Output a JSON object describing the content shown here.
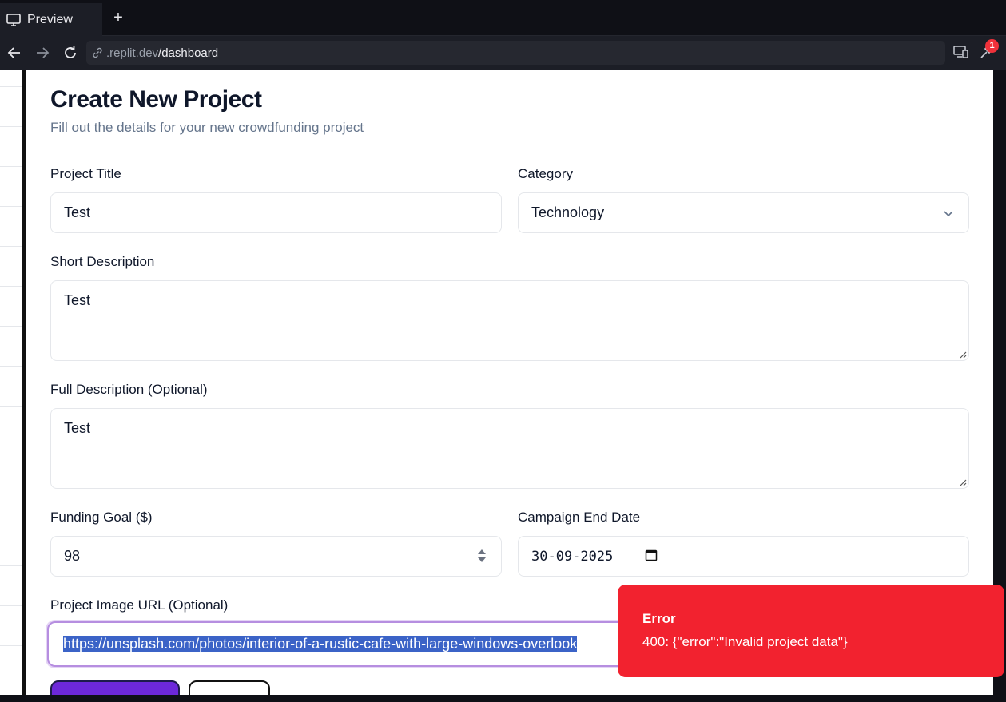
{
  "browser": {
    "tab_label": "Preview",
    "url_prefix": ".replit.dev",
    "url_path": "/dashboard",
    "badge_count": "1"
  },
  "form": {
    "title": "Create New Project",
    "subtitle": "Fill out the details for your new crowdfunding project",
    "project_title": {
      "label": "Project Title",
      "value": "Test"
    },
    "category": {
      "label": "Category",
      "value": "Technology"
    },
    "short_description": {
      "label": "Short Description",
      "value": "Test"
    },
    "full_description": {
      "label": "Full Description (Optional)",
      "value": "Test"
    },
    "funding_goal": {
      "label": "Funding Goal ($)",
      "value": "98"
    },
    "end_date": {
      "label": "Campaign End Date",
      "value": "30-09-2025"
    },
    "image_url": {
      "label": "Project Image URL (Optional)",
      "value": "https://unsplash.com/photos/interior-of-a-rustic-cafe-with-large-windows-overlook"
    }
  },
  "toast": {
    "title": "Error",
    "message": "400: {\"error\":\"Invalid project data\"}"
  },
  "colors": {
    "accent": "#6d28d9",
    "error": "#f2222f",
    "focus": "#b68ee0"
  }
}
